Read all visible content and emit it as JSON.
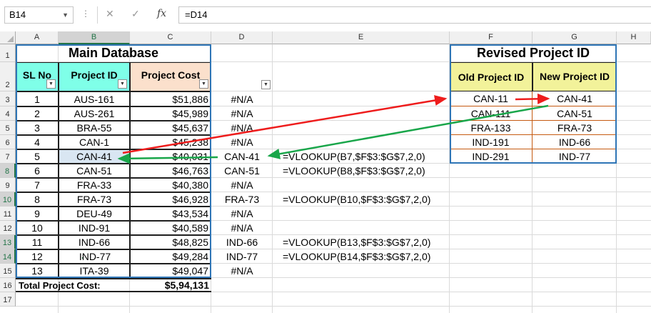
{
  "formula_bar": {
    "name_box": "B14",
    "cancel_icon": "✕",
    "enter_icon": "✓",
    "fx_icon": "fx",
    "formula": "=D14"
  },
  "columns": [
    "A",
    "B",
    "C",
    "D",
    "E",
    "F",
    "G",
    "H"
  ],
  "selected_column": "B",
  "rows": [
    "1",
    "2",
    "3",
    "4",
    "5",
    "6",
    "7",
    "8",
    "9",
    "10",
    "11",
    "12",
    "13",
    "14",
    "15",
    "16",
    "17"
  ],
  "selected_rows": [
    "8",
    "10",
    "13",
    "14"
  ],
  "main_db": {
    "title": "Main Database",
    "headers": {
      "sl": "SL No",
      "project_id": "Project ID",
      "cost": "Project Cost"
    },
    "records": [
      {
        "sl": "1",
        "id": "AUS-161",
        "cost": "$51,886"
      },
      {
        "sl": "2",
        "id": "AUS-261",
        "cost": "$45,989"
      },
      {
        "sl": "3",
        "id": "BRA-55",
        "cost": "$45,637"
      },
      {
        "sl": "4",
        "id": "CAN-1",
        "cost": "$45,238"
      },
      {
        "sl": "5",
        "id": "CAN-41",
        "cost": "$40,031"
      },
      {
        "sl": "6",
        "id": "CAN-51",
        "cost": "$46,763"
      },
      {
        "sl": "7",
        "id": "FRA-33",
        "cost": "$40,380"
      },
      {
        "sl": "8",
        "id": "FRA-73",
        "cost": "$46,928"
      },
      {
        "sl": "9",
        "id": "DEU-49",
        "cost": "$43,534"
      },
      {
        "sl": "10",
        "id": "IND-91",
        "cost": "$40,589"
      },
      {
        "sl": "11",
        "id": "IND-66",
        "cost": "$48,825"
      },
      {
        "sl": "12",
        "id": "IND-77",
        "cost": "$49,284"
      },
      {
        "sl": "13",
        "id": "ITA-39",
        "cost": "$49,047"
      }
    ],
    "total_label": "Total Project Cost:",
    "total_value": "$5,94,131"
  },
  "column_d": [
    "#N/A",
    "#N/A",
    "#N/A",
    "#N/A",
    "CAN-41",
    "CAN-51",
    "#N/A",
    "FRA-73",
    "#N/A",
    "#N/A",
    "IND-66",
    "IND-77",
    "#N/A"
  ],
  "column_e": [
    "",
    "",
    "",
    "",
    "=VLOOKUP(B7,$F$3:$G$7,2,0)",
    "=VLOOKUP(B8,$F$3:$G$7,2,0)",
    "",
    "=VLOOKUP(B10,$F$3:$G$7,2,0)",
    "",
    "",
    "=VLOOKUP(B13,$F$3:$G$7,2,0)",
    "=VLOOKUP(B14,$F$3:$G$7,2,0)",
    ""
  ],
  "revised": {
    "title": "Revised Project ID",
    "old_header": "Old Project ID",
    "new_header": "New Project ID",
    "rows": [
      {
        "old": "CAN-11",
        "new": "CAN-41"
      },
      {
        "old": "CAN-111",
        "new": "CAN-51"
      },
      {
        "old": "FRA-133",
        "new": "FRA-73"
      },
      {
        "old": "IND-191",
        "new": "IND-66"
      },
      {
        "old": "IND-291",
        "new": "IND-77"
      }
    ]
  },
  "colors": {
    "header_cyan": "#7fffe8",
    "header_peach": "#fbe0cc",
    "header_yellow": "#f2f29a",
    "selected_b_fill": "#d9e6f2",
    "gray_fill": "#a6a6a6",
    "frame_blue": "#2e75b6",
    "arrow_red": "#ee1c1c",
    "arrow_green": "#19a64a",
    "excel_green": "#217346"
  }
}
